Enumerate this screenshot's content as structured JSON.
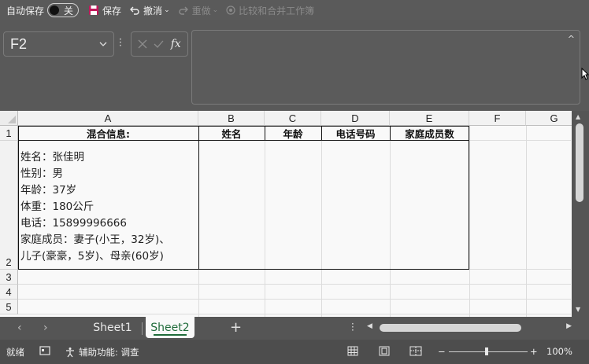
{
  "toolbar": {
    "autosave_label": "自动保存",
    "autosave_state": "关",
    "save_label": "保存",
    "undo_label": "撤消",
    "redo_label": "重做",
    "compare_label": "比较和合并工作簿"
  },
  "formula_bar": {
    "name_box": "F2",
    "fx_label": "fx",
    "formula": ""
  },
  "columns": [
    "A",
    "B",
    "C",
    "D",
    "E",
    "F",
    "G"
  ],
  "rows": [
    "1",
    "2",
    "3",
    "4",
    "5"
  ],
  "cells": {
    "A1": "混合信息:",
    "B1": "姓名",
    "C1": "年龄",
    "D1": "电话号码",
    "E1": "家庭成员数",
    "A2_lines": [
      "姓名：张佳明",
      "性别：男",
      "年龄：37岁",
      "体重：180公斤",
      "电话：15899996666",
      "家庭成员：妻子(小王，32岁)、",
      "儿子(豪豪，5岁)、母亲(60岁)"
    ]
  },
  "sheets": {
    "tab1": "Sheet1",
    "tab2": "Sheet2",
    "active": "Sheet2"
  },
  "status": {
    "ready": "就绪",
    "accessibility": "辅助功能: 调查",
    "zoom": "100%"
  }
}
